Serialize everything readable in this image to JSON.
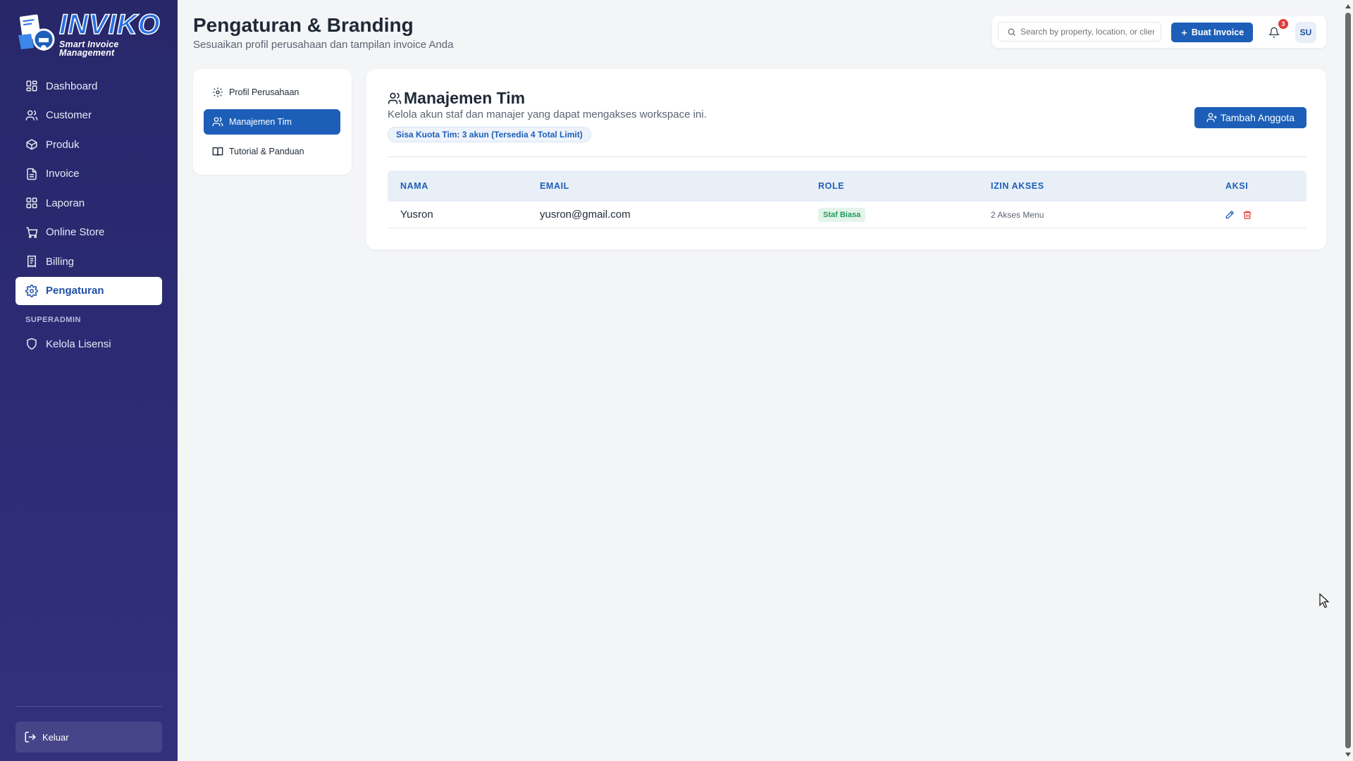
{
  "brand": {
    "name": "INVIKO",
    "tagline": "Smart Invoice Management"
  },
  "sidebar": {
    "items": [
      {
        "label": "Dashboard",
        "icon": "dashboard-icon"
      },
      {
        "label": "Customer",
        "icon": "users-icon"
      },
      {
        "label": "Produk",
        "icon": "box-icon"
      },
      {
        "label": "Invoice",
        "icon": "file-icon"
      },
      {
        "label": "Laporan",
        "icon": "report-icon"
      },
      {
        "label": "Online Store",
        "icon": "cart-icon"
      },
      {
        "label": "Billing",
        "icon": "receipt-icon"
      },
      {
        "label": "Pengaturan",
        "icon": "gear-icon",
        "active": true
      }
    ],
    "section_label": "SUPERADMIN",
    "admin_items": [
      {
        "label": "Kelola Lisensi",
        "icon": "shield-icon"
      }
    ],
    "logout_label": "Keluar"
  },
  "header": {
    "title": "Pengaturan & Branding",
    "subtitle": "Sesuaikan profil perusahaan dan tampilan invoice Anda",
    "search_placeholder": "Search by property, location, or client",
    "create_button": "Buat Invoice",
    "notification_count": "3",
    "user_initials": "SU"
  },
  "settings_tabs": [
    {
      "label": "Profil Perusahaan",
      "icon": "gear-icon"
    },
    {
      "label": "Manajemen Tim",
      "icon": "users-icon",
      "active": true
    },
    {
      "label": "Tutorial & Panduan",
      "icon": "book-icon"
    }
  ],
  "team": {
    "title": "Manajemen Tim",
    "description": "Kelola akun staf dan manajer yang dapat mengakses workspace ini.",
    "quota": "Sisa Kuota Tim: 3 akun (Tersedia 4 Total Limit)",
    "add_button": "Tambah Anggota",
    "columns": [
      "NAMA",
      "EMAIL",
      "ROLE",
      "IZIN AKSES",
      "AKSI"
    ],
    "rows": [
      {
        "name": "Yusron",
        "email": "yusron@gmail.com",
        "role": "Staf Biasa",
        "access": "2 Akses Menu"
      }
    ]
  },
  "colors": {
    "sidebar": "#2b2a72",
    "primary": "#1d5fb8",
    "danger": "#e23c3c",
    "role_badge": "#1f9a5a"
  }
}
